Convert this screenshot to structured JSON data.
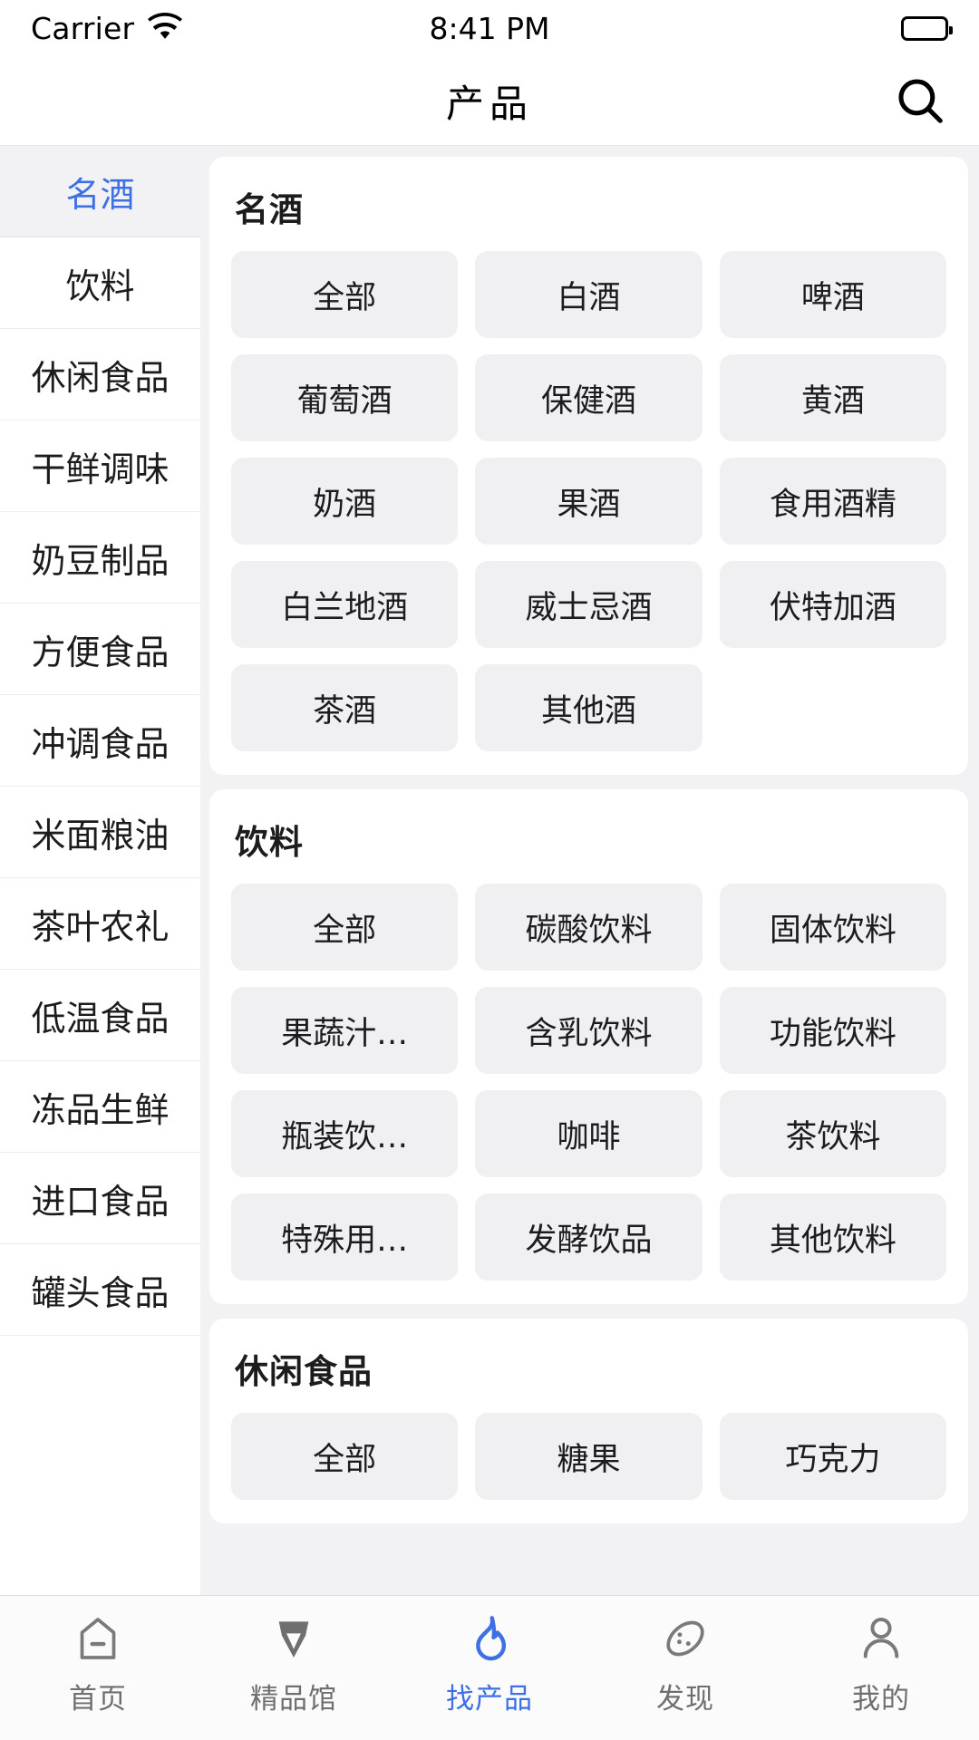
{
  "status_bar": {
    "carrier": "Carrier",
    "wifi_icon": "wifi-icon",
    "time": "8:41 PM",
    "battery_icon": "battery-full-icon"
  },
  "nav": {
    "title": "产品",
    "search_icon": "search-icon"
  },
  "sidebar": {
    "items": [
      {
        "label": "名酒",
        "active": true
      },
      {
        "label": "饮料",
        "active": false
      },
      {
        "label": "休闲食品",
        "active": false
      },
      {
        "label": "干鲜调味",
        "active": false
      },
      {
        "label": "奶豆制品",
        "active": false
      },
      {
        "label": "方便食品",
        "active": false
      },
      {
        "label": "冲调食品",
        "active": false
      },
      {
        "label": "米面粮油",
        "active": false
      },
      {
        "label": "茶叶农礼",
        "active": false
      },
      {
        "label": "低温食品",
        "active": false
      },
      {
        "label": "冻品生鲜",
        "active": false
      },
      {
        "label": "进口食品",
        "active": false
      },
      {
        "label": "罐头食品",
        "active": false
      }
    ]
  },
  "content": {
    "sections": [
      {
        "title": "名酒",
        "chips": [
          "全部",
          "白酒",
          "啤酒",
          "葡萄酒",
          "保健酒",
          "黄酒",
          "奶酒",
          "果酒",
          "食用酒精",
          "白兰地酒",
          "威士忌酒",
          "伏特加酒",
          "茶酒",
          "其他酒"
        ]
      },
      {
        "title": "饮料",
        "chips": [
          "全部",
          "碳酸饮料",
          "固体饮料",
          "果蔬汁…",
          "含乳饮料",
          "功能饮料",
          "瓶装饮…",
          "咖啡",
          "茶饮料",
          "特殊用…",
          "发酵饮品",
          "其他饮料"
        ]
      },
      {
        "title": "休闲食品",
        "chips": [
          "全部",
          "糖果",
          "巧克力"
        ]
      }
    ]
  },
  "tabbar": {
    "tabs": [
      {
        "label": "首页",
        "icon": "home-icon",
        "active": false
      },
      {
        "label": "精品馆",
        "icon": "pen-nib-icon",
        "active": false
      },
      {
        "label": "找产品",
        "icon": "flame-icon",
        "active": true
      },
      {
        "label": "发现",
        "icon": "palette-icon",
        "active": false
      },
      {
        "label": "我的",
        "icon": "person-icon",
        "active": false
      }
    ]
  },
  "colors": {
    "accent": "#3d6fe5",
    "page_bg": "#f2f2f4",
    "card_bg": "#ffffff",
    "chip_bg": "#f0f0f2",
    "text": "#1c1c1e",
    "muted": "#6f6f72"
  }
}
